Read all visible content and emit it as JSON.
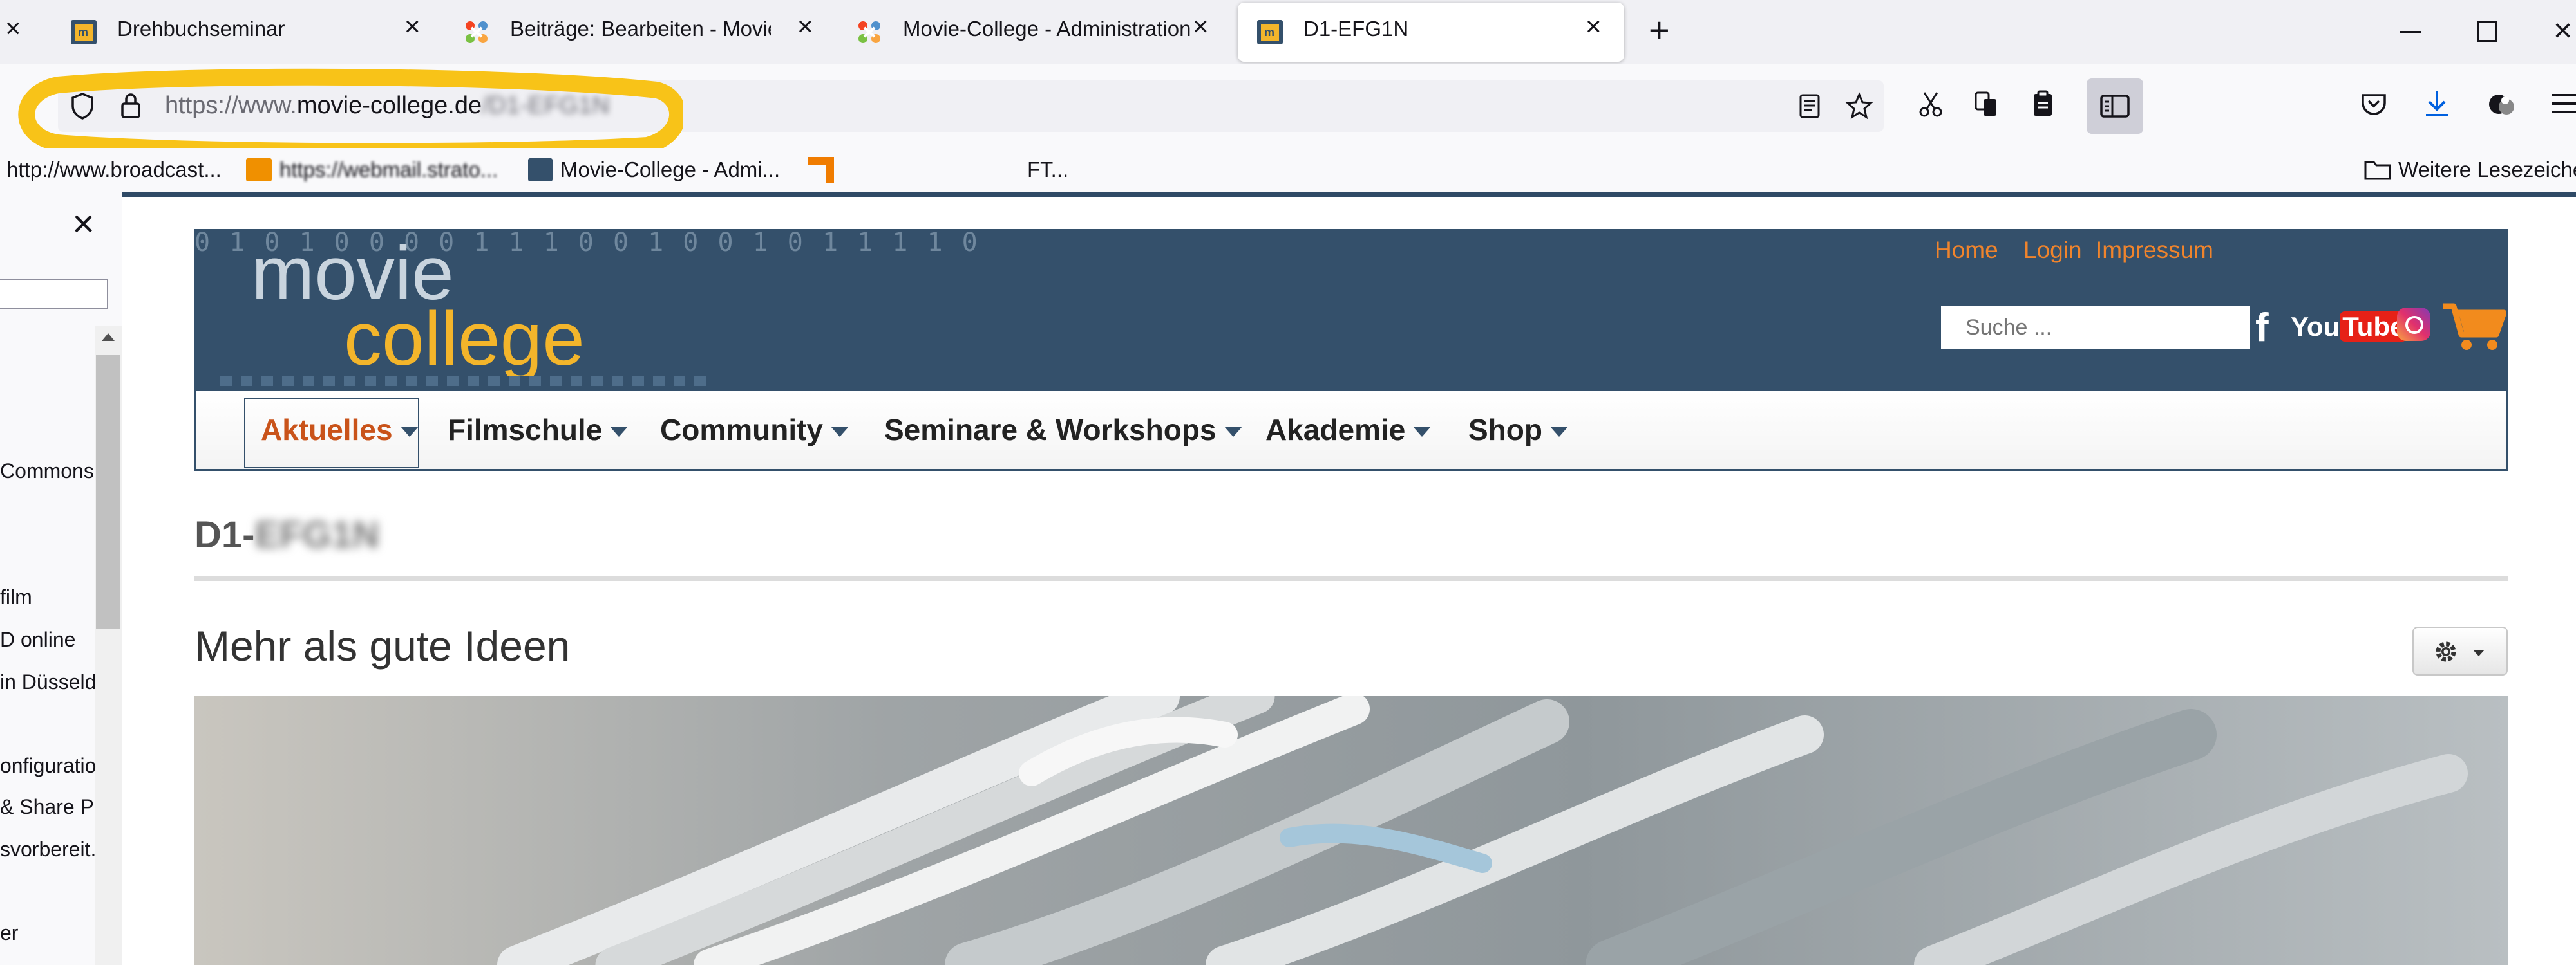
{
  "browser": {
    "tabs": [
      {
        "title": "Drehbuchseminar",
        "icon": "movie-college-favicon",
        "active": false
      },
      {
        "title": "Beiträge: Bearbeiten - Movie-Co",
        "icon": "joomla-favicon",
        "active": false
      },
      {
        "title": "Movie-College - Administration",
        "icon": "joomla-favicon",
        "active": false
      },
      {
        "title": "D1-EFG1N",
        "icon": "movie-college-favicon",
        "active": true
      }
    ],
    "new_tab_label": "+",
    "url": {
      "prefix": "https://www.",
      "domain": "movie-college.de",
      "path": "/D1-EFG1N"
    },
    "bookmarks": [
      {
        "label": "http://www.broadcast...",
        "icon": "none"
      },
      {
        "label": "https://webmail.strato...",
        "icon": "strato-icon"
      },
      {
        "label": "Movie-College - Admi...",
        "icon": "movie-college-favicon"
      },
      {
        "label": "",
        "icon": "orange-square-icon"
      },
      {
        "label": "FT...",
        "icon": "none"
      },
      {
        "label": "Weitere Lesezeichen",
        "icon": "folder-icon"
      }
    ]
  },
  "sidebar": {
    "items": [
      "Commons",
      "film",
      "D online",
      "in Düsseld",
      "onfiguratio",
      "& Share P",
      "svorbereit.",
      "er"
    ]
  },
  "site": {
    "logo_line1": "movie",
    "logo_line2": "college",
    "logo_digits": "0 1 0 1 0 0 0 0 1 1 1 0 0 1 0 0 1 0 1 1 1 1 0",
    "top_links": [
      "Home",
      "Login",
      "Impressum"
    ],
    "search_placeholder": "Suche ...",
    "social": {
      "facebook": "f",
      "youtube_you": "You",
      "youtube_tube": "Tube"
    },
    "menu": [
      {
        "label": "Aktuelles",
        "active": true
      },
      {
        "label": "Filmschule",
        "active": false
      },
      {
        "label": "Community",
        "active": false
      },
      {
        "label": "Seminare & Workshops",
        "active": false
      },
      {
        "label": "Akademie",
        "active": false
      },
      {
        "label": "Shop",
        "active": false
      }
    ],
    "page_title_visible": "D1-",
    "page_title_blurred": "EFG1N",
    "article_title": "Mehr als gute Ideen"
  },
  "colors": {
    "header_bg": "#34506b",
    "accent_orange": "#f0842c",
    "logo_yellow": "#f3b52b",
    "annotation_yellow": "#f8c318"
  }
}
